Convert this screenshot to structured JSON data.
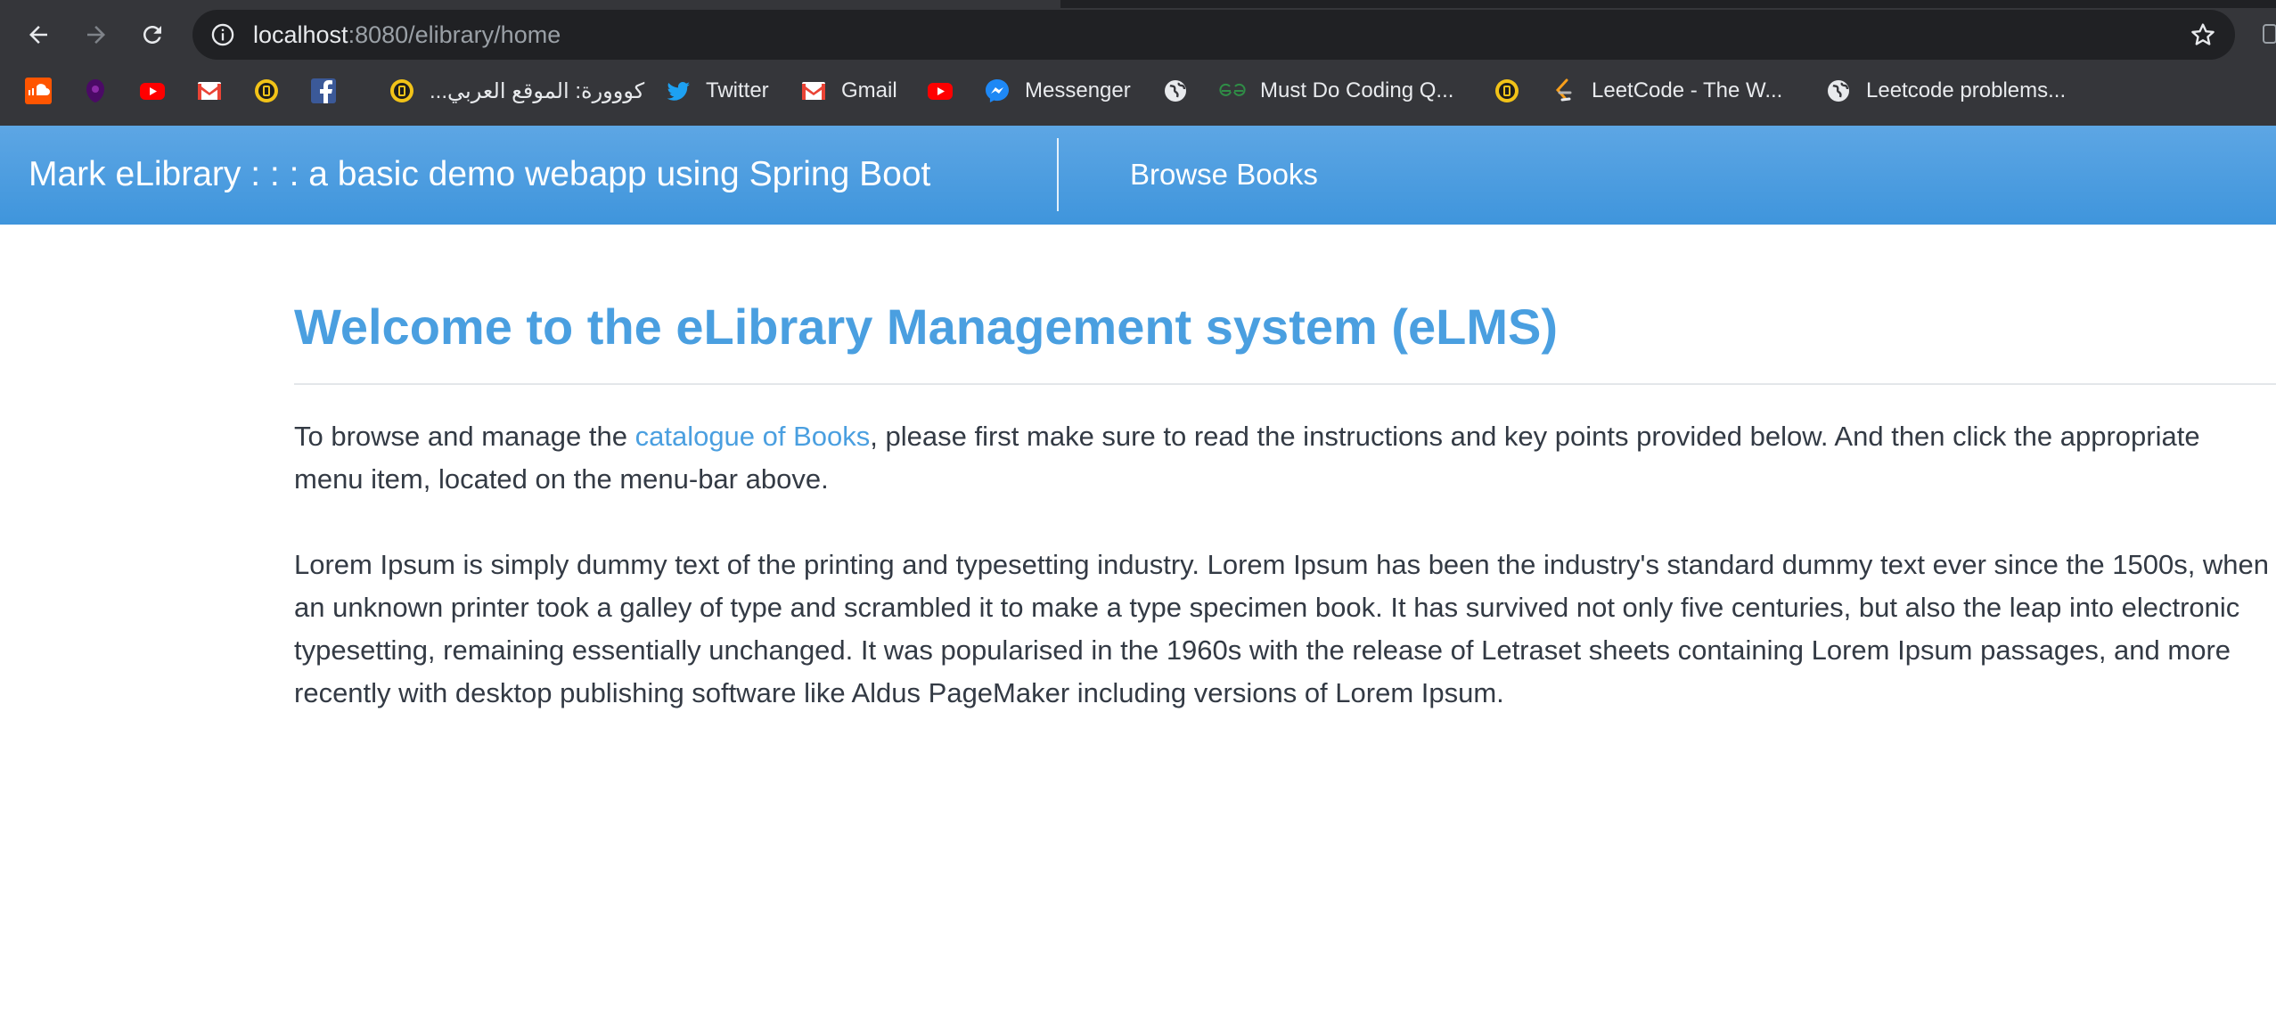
{
  "browser": {
    "url_host": "localhost",
    "url_path": ":8080/elibrary/home",
    "bookmarks": [
      {
        "icon": "soundcloud-icon",
        "label": ""
      },
      {
        "icon": "premier-league-icon",
        "label": ""
      },
      {
        "icon": "youtube-icon",
        "label": ""
      },
      {
        "icon": "gmail-icon",
        "label": ""
      },
      {
        "icon": "yellow-badge-icon",
        "label": ""
      },
      {
        "icon": "facebook-icon",
        "label": ""
      },
      {
        "icon": "yellow-badge-icon",
        "label": "كووورة: الموقع العربي..."
      },
      {
        "icon": "twitter-icon",
        "label": "Twitter"
      },
      {
        "icon": "gmail-icon",
        "label": "Gmail"
      },
      {
        "icon": "youtube-icon",
        "label": ""
      },
      {
        "icon": "messenger-icon",
        "label": "Messenger"
      },
      {
        "icon": "globe-icon",
        "label": ""
      },
      {
        "icon": "geeksforgeeks-icon",
        "label": "Must Do Coding Q..."
      },
      {
        "icon": "yellow-badge-icon",
        "label": ""
      },
      {
        "icon": "leetcode-icon",
        "label": "LeetCode - The W..."
      },
      {
        "icon": "globe-icon",
        "label": "Leetcode problems..."
      }
    ]
  },
  "navbar": {
    "brand": "Mark eLibrary : : : a basic demo webapp using Spring Boot",
    "browse_books": "Browse Books"
  },
  "main": {
    "title": "Welcome to the eLibrary Management system (eLMS)",
    "intro_before": "To browse and manage the ",
    "intro_link": "catalogue of Books",
    "intro_after": ", please first make sure to read the instructions and key points provided below. And then click the appropriate menu item, located on the menu-bar above.",
    "lorem": "Lorem Ipsum is simply dummy text of the printing and typesetting industry. Lorem Ipsum has been the industry's standard dummy text ever since the 1500s, when an unknown printer took a galley of type and scrambled it to make a type specimen book. It has survived not only five centuries, but also the leap into electronic typesetting, remaining essentially unchanged. It was popularised in the 1960s with the release of Letraset sheets containing Lorem Ipsum passages, and more recently with desktop publishing software like Aldus PageMaker including versions of Lorem Ipsum."
  },
  "colors": {
    "navbar_top": "#5da6e4",
    "navbar_bottom": "#3f95dc",
    "accent": "#4a9fe0",
    "body_text": "#333a44",
    "chrome_bg": "#35363a",
    "omnibox_bg": "#202124"
  }
}
